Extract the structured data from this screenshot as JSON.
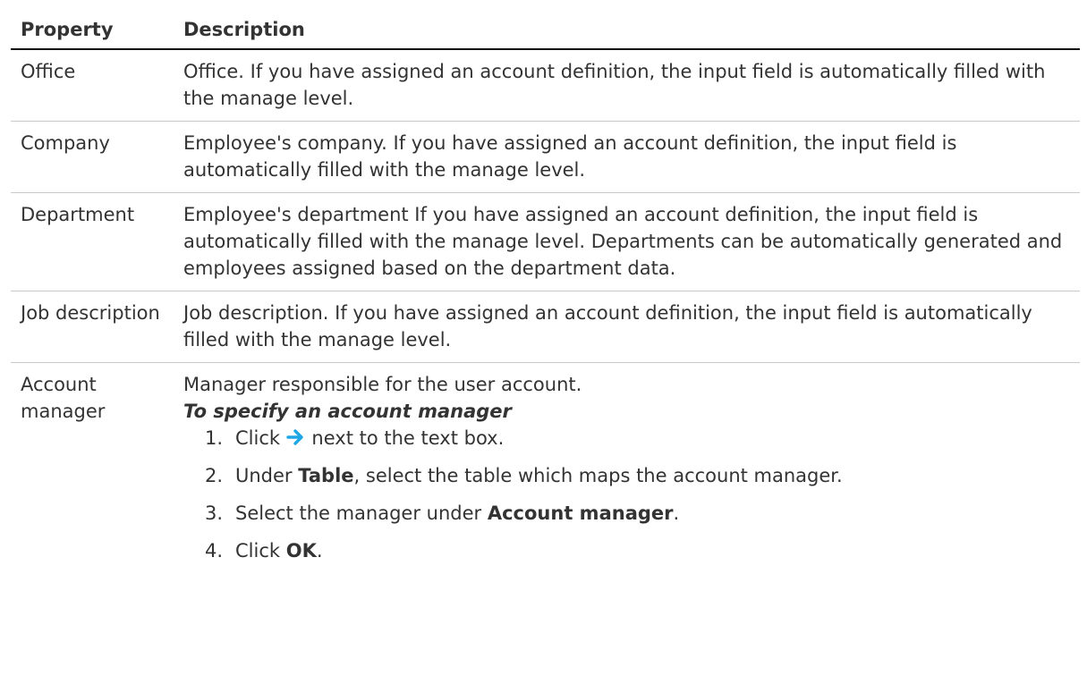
{
  "table": {
    "headers": [
      "Property",
      "Description"
    ],
    "rows": [
      {
        "property": "Office",
        "description": "Office. If you have assigned an account definition, the input field is automatically filled with the manage level."
      },
      {
        "property": "Company",
        "description": "Employee's company. If you have assigned an account definition, the input field is automatically filled with the manage level."
      },
      {
        "property": "Department",
        "description": "Employee's department If you have assigned an account definition, the input field is automatically filled with the manage level. Departments can be automatically generated and employees assigned based on the department data."
      },
      {
        "property": "Job description",
        "description": "Job description. If you have assigned an account definition, the input field is automatically filled with the manage level."
      },
      {
        "property": "Account manager",
        "description": "Manager responsible for the user account.",
        "procedure_title": "To specify an account manager",
        "steps": {
          "s1": {
            "pre": "Click",
            "icon": "arrow-right-icon",
            "post": "next to the text box."
          },
          "s2": {
            "pre": "Under",
            "bold": "Table",
            "post": ", select the table which maps the account manager."
          },
          "s3": {
            "pre": "Select the manager under",
            "bold": "Account manager",
            "post": "."
          },
          "s4": {
            "pre": "Click",
            "bold": "OK",
            "post": "."
          }
        }
      }
    ]
  },
  "colors": {
    "text": "#333333",
    "header_rule": "#0d0d0d",
    "row_rule": "#c9c9c9",
    "arrow": "#1ea7e4"
  }
}
